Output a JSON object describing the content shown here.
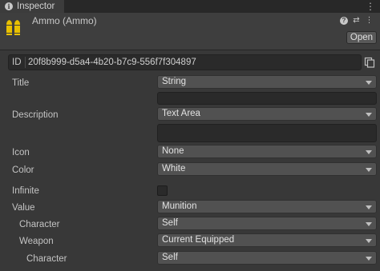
{
  "tab": {
    "title": "Inspector",
    "icon": "info-icon"
  },
  "asset": {
    "title": "Ammo (Ammo)",
    "icon": "ammo-icon",
    "open_label": "Open"
  },
  "id": {
    "label": "ID",
    "value": "20f8b999-d5a4-4b20-b7c9-556f7f304897"
  },
  "fields": {
    "title": {
      "label": "Title",
      "type": "String"
    },
    "description": {
      "label": "Description",
      "type": "Text Area"
    },
    "icon": {
      "label": "Icon",
      "value": "None"
    },
    "color": {
      "label": "Color",
      "value": "White"
    },
    "infinite": {
      "label": "Infinite",
      "checked": false
    },
    "value": {
      "label": "Value",
      "value": "Munition"
    },
    "character": {
      "label": "Character",
      "value": "Self"
    },
    "weapon": {
      "label": "Weapon",
      "value": "Current Equipped"
    },
    "weapon_character": {
      "label": "Character",
      "value": "Self"
    }
  },
  "colors": {
    "accent_ammo": "#e8c000",
    "panel": "#383838",
    "field": "#515151"
  }
}
